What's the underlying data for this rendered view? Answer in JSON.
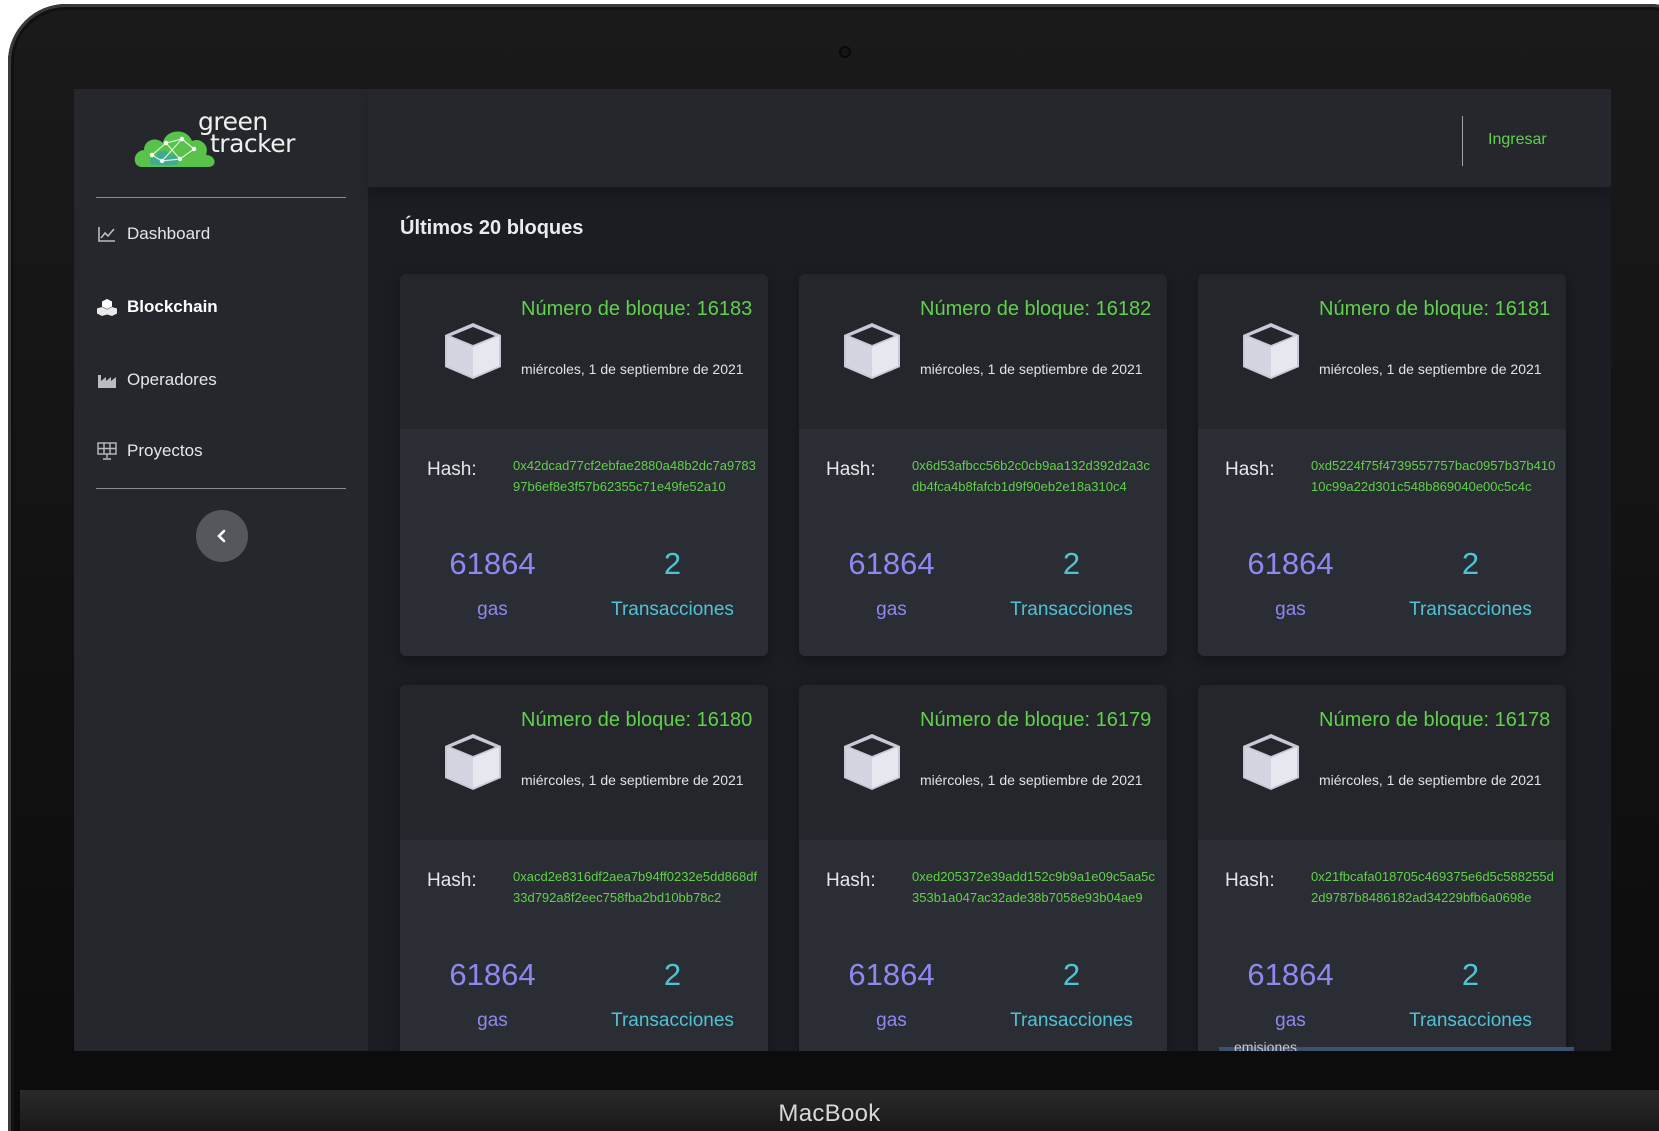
{
  "device": {
    "label": "MacBook"
  },
  "brand": {
    "line1": "green",
    "line2": "tracker"
  },
  "sidebar": {
    "items": [
      {
        "label": "Dashboard",
        "icon": "chart-line-icon"
      },
      {
        "label": "Blockchain",
        "icon": "cubes-icon",
        "active": true
      },
      {
        "label": "Operadores",
        "icon": "industry-icon"
      },
      {
        "label": "Proyectos",
        "icon": "solar-panel-icon"
      }
    ],
    "collapse_icon": "chevron-left-icon"
  },
  "topbar": {
    "login_label": "Ingresar"
  },
  "page": {
    "title": "Últimos 20 bloques"
  },
  "card_labels": {
    "hash": "Hash:",
    "gas": "gas",
    "transactions": "Transacciones"
  },
  "blocks": [
    {
      "title": "Número de bloque: 16183",
      "date": "miércoles, 1 de septiembre de 2021",
      "hash": "0x42dcad77cf2ebfae2880a48b2dc7a978397b6ef8e3f57b62355c71e49fe52a10",
      "gas": "61864",
      "tx": "2"
    },
    {
      "title": "Número de bloque: 16182",
      "date": "miércoles, 1 de septiembre de 2021",
      "hash": "0x6d53afbcc56b2c0cb9aa132d392d2a3cdb4fca4b8fafcb1d9f90eb2e18a310c4",
      "gas": "61864",
      "tx": "2"
    },
    {
      "title": "Número de bloque: 16181",
      "date": "miércoles, 1 de septiembre de 2021",
      "hash": "0xd5224f75f4739557757bac0957b37b41010c99a22d301c548b869040e00c5c4c",
      "gas": "61864",
      "tx": "2"
    },
    {
      "title": "Número de bloque: 16180",
      "date": "miércoles, 1 de septiembre de 2021",
      "hash": "0xacd2e8316df2aea7b94ff0232e5dd868df33d792a8f2eec758fba2bd10bb78c2",
      "gas": "61864",
      "tx": "2"
    },
    {
      "title": "Número de bloque: 16179",
      "date": "miércoles, 1 de septiembre de 2021",
      "hash": "0xed205372e39add152c9b9a1e09c5aa5c353b1a047ac32ade38b7058e93b04ae9",
      "gas": "61864",
      "tx": "2"
    },
    {
      "title": "Número de bloque: 16178",
      "date": "miércoles, 1 de septiembre de 2021",
      "hash": "0x21fbcafa018705c469375e6d5c588255d2d9787b8486182ad34229bfb6a0698e",
      "gas": "61864",
      "tx": "2"
    }
  ],
  "peek": {
    "text": "emisiones"
  },
  "colors": {
    "accent_green": "#5fd14a",
    "gas_purple": "#8e87f0",
    "tx_cyan": "#4fc3d6",
    "panel": "#25272d"
  }
}
